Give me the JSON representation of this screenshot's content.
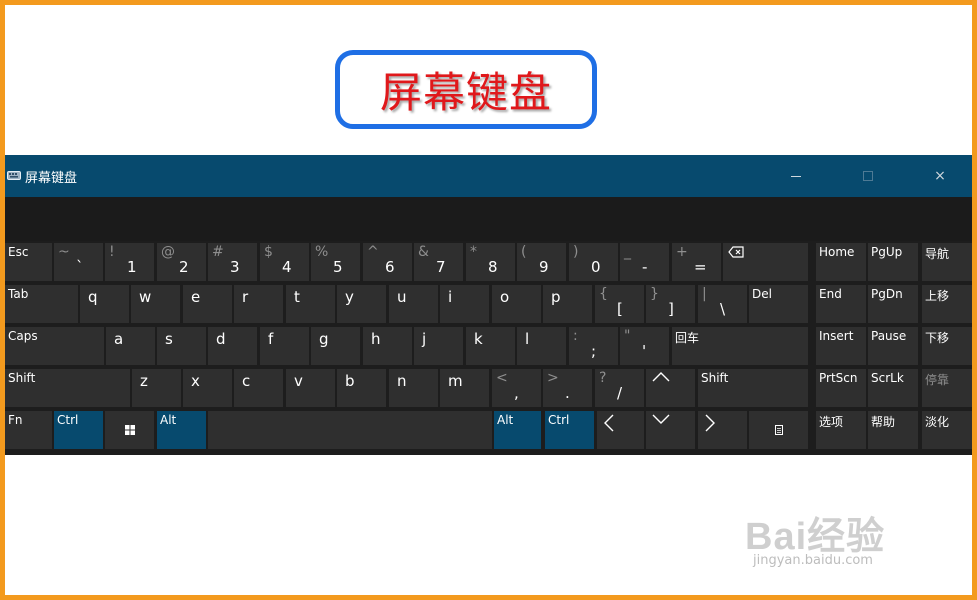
{
  "page_title": "屏幕键盘",
  "window": {
    "title": "屏幕键盘",
    "controls": {
      "minimize": "minimize",
      "maximize": "maximize",
      "close": "×"
    }
  },
  "keys": {
    "esc": "Esc",
    "backquote": {
      "shift": "~",
      "main": "`"
    },
    "digit1": {
      "shift": "!",
      "main": "1"
    },
    "digit2": {
      "shift": "@",
      "main": "2"
    },
    "digit3": {
      "shift": "#",
      "main": "3"
    },
    "digit4": {
      "shift": "$",
      "main": "4"
    },
    "digit5": {
      "shift": "%",
      "main": "5"
    },
    "digit6": {
      "shift": "^",
      "main": "6"
    },
    "digit7": {
      "shift": "&",
      "main": "7"
    },
    "digit8": {
      "shift": "*",
      "main": "8"
    },
    "digit9": {
      "shift": "(",
      "main": "9"
    },
    "digit0": {
      "shift": ")",
      "main": "0"
    },
    "minus": {
      "shift": "_",
      "main": "-"
    },
    "equal": {
      "shift": "+",
      "main": "="
    },
    "tab": "Tab",
    "q": "q",
    "w": "w",
    "e": "e",
    "r": "r",
    "t": "t",
    "y": "y",
    "u": "u",
    "i": "i",
    "o": "o",
    "p": "p",
    "bracket_left": {
      "shift": "{",
      "main": "["
    },
    "bracket_right": {
      "shift": "}",
      "main": "]"
    },
    "backslash": {
      "shift": "|",
      "main": "\\"
    },
    "del": "Del",
    "caps": "Caps",
    "a": "a",
    "s": "s",
    "d": "d",
    "f": "f",
    "g": "g",
    "h": "h",
    "j": "j",
    "k": "k",
    "l": "l",
    "semicolon": {
      "shift": ":",
      "main": ";"
    },
    "quote": {
      "shift": "\"",
      "main": "'"
    },
    "enter": "回车",
    "shift_left": "Shift",
    "z": "z",
    "x": "x",
    "c": "c",
    "v": "v",
    "b": "b",
    "n": "n",
    "m": "m",
    "comma": {
      "shift": "<",
      "main": ","
    },
    "period": {
      "shift": ">",
      "main": "."
    },
    "slash": {
      "shift": "?",
      "main": "/"
    },
    "shift_right": "Shift",
    "fn": "Fn",
    "ctrl_left": "Ctrl",
    "alt_left": "Alt",
    "alt_right": "Alt",
    "ctrl_right": "Ctrl",
    "home": "Home",
    "pgup": "PgUp",
    "nav": "导航",
    "end": "End",
    "pgdn": "PgDn",
    "moveup": "上移",
    "insert": "Insert",
    "pause": "Pause",
    "movedown": "下移",
    "prtscn": "PrtScn",
    "scrlk": "ScrLk",
    "dock": "停靠",
    "options": "选项",
    "help": "帮助",
    "fade": "淡化"
  },
  "watermark": {
    "brand": "Bai经验",
    "url": "jingyan.baidu.com"
  },
  "colors": {
    "frame": "#f39a1e",
    "title_border": "#1f6fe5",
    "title_text": "#e0181b",
    "titlebar": "#074a6e",
    "key": "#2f2f2f",
    "key_active": "#074a6e",
    "keyboard_bg": "#1d1d1d"
  }
}
